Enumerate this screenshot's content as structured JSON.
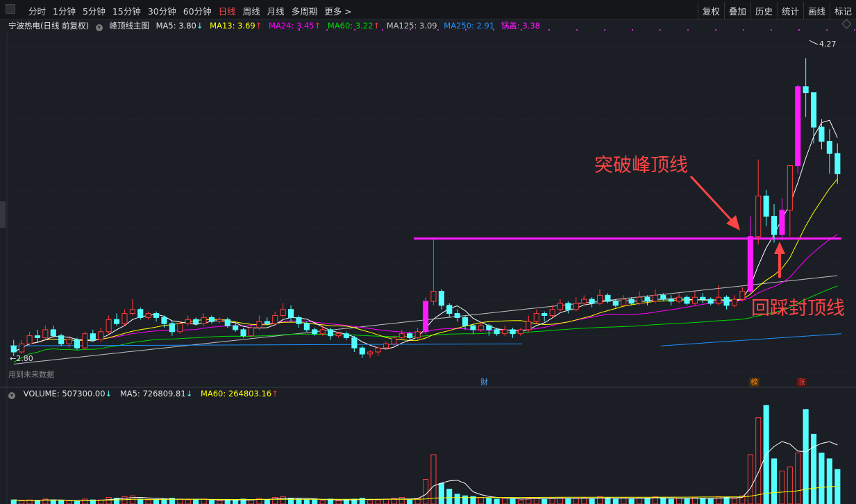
{
  "toolbar": {
    "periods": [
      "分时",
      "1分钟",
      "5分钟",
      "15分钟",
      "30分钟",
      "60分钟",
      "日线",
      "周线",
      "月线",
      "多周期",
      "更多 >"
    ],
    "active": "日线",
    "right_buttons": [
      "复权",
      "叠加",
      "历史",
      "统计",
      "画线",
      "标记"
    ]
  },
  "info": {
    "stock": "宁波热电(日线 前复权)",
    "indicator": "峰顶线主图",
    "ma5": "MA5: 3.80",
    "ma13": "MA13: 3.69",
    "ma24": "MA24: 3.45",
    "ma60": "MA60: 3.22",
    "ma125": "MA125: 3.09",
    "ma250": "MA250: 2.91",
    "guogai": "锅盖: 3.38"
  },
  "price_labels": {
    "high": "4.27",
    "low": "2.80",
    "future_note": "用到未来数据"
  },
  "badges": {
    "cai": "财",
    "bang": "榜",
    "zhang": "涨"
  },
  "annotations": {
    "breakout": "突破峰顶线",
    "pullback": "回踩封顶线"
  },
  "volume": {
    "volume": "VOLUME: 507300.00",
    "ma5": "MA5: 726809.81",
    "ma60": "MA60: 264803.16"
  },
  "colors": {
    "bg": "#1b1e25",
    "up": "#ff3b3b",
    "down": "#54ffff",
    "magenta": "#ff1aff",
    "ma5": "#ffffff",
    "ma13": "#ffff00",
    "ma24": "#ff00ff",
    "ma60": "#00d800",
    "ma125": "#c0c0c0",
    "ma250": "#1e90ff",
    "annotation": "#ff4545"
  },
  "chart_data": {
    "type": "candlestick",
    "ylim": [
      2.7,
      4.4
    ],
    "peak_line": 3.38,
    "candles": [
      [
        2.85,
        2.82,
        2.88,
        2.8
      ],
      [
        2.82,
        2.86,
        2.88,
        2.81
      ],
      [
        2.86,
        2.9,
        2.92,
        2.85
      ],
      [
        2.9,
        2.89,
        2.93,
        2.87
      ],
      [
        2.89,
        2.93,
        2.95,
        2.88
      ],
      [
        2.93,
        2.9,
        2.95,
        2.89
      ],
      [
        2.9,
        2.86,
        2.91,
        2.85
      ],
      [
        2.86,
        2.88,
        2.9,
        2.84
      ],
      [
        2.88,
        2.84,
        2.89,
        2.83
      ],
      [
        2.84,
        2.91,
        2.92,
        2.83
      ],
      [
        2.91,
        2.88,
        2.93,
        2.87
      ],
      [
        2.88,
        2.92,
        2.94,
        2.87
      ],
      [
        2.92,
        2.98,
        3.0,
        2.91
      ],
      [
        2.98,
        2.96,
        3.01,
        2.95
      ],
      [
        2.96,
        3.01,
        3.03,
        2.95
      ],
      [
        3.01,
        3.03,
        3.08,
        3.0
      ],
      [
        3.03,
        2.99,
        3.04,
        2.98
      ],
      [
        2.99,
        3.01,
        3.02,
        2.98
      ],
      [
        3.01,
        2.99,
        3.02,
        2.97
      ],
      [
        2.99,
        2.96,
        3.0,
        2.94
      ],
      [
        2.96,
        2.92,
        2.97,
        2.9
      ],
      [
        2.92,
        2.96,
        2.97,
        2.91
      ],
      [
        2.96,
        2.98,
        3.0,
        2.95
      ],
      [
        2.98,
        2.96,
        2.99,
        2.95
      ],
      [
        2.96,
        2.99,
        3.01,
        2.95
      ],
      [
        2.99,
        2.97,
        3.0,
        2.96
      ],
      [
        2.97,
        2.98,
        2.99,
        2.96
      ],
      [
        2.98,
        2.95,
        2.99,
        2.94
      ],
      [
        2.95,
        2.93,
        2.96,
        2.92
      ],
      [
        2.93,
        2.9,
        2.94,
        2.89
      ],
      [
        2.9,
        2.94,
        2.95,
        2.89
      ],
      [
        2.94,
        2.97,
        3.0,
        2.93
      ],
      [
        2.97,
        2.96,
        2.99,
        2.95
      ],
      [
        2.96,
        3.0,
        3.02,
        2.95
      ],
      [
        3.0,
        3.03,
        3.06,
        2.99
      ],
      [
        3.03,
        2.99,
        3.05,
        2.97
      ],
      [
        2.99,
        2.96,
        3.0,
        2.94
      ],
      [
        2.96,
        2.93,
        2.97,
        2.92
      ],
      [
        2.93,
        2.91,
        2.94,
        2.9
      ],
      [
        2.91,
        2.93,
        2.95,
        2.9
      ],
      [
        2.93,
        2.9,
        2.94,
        2.88
      ],
      [
        2.9,
        2.91,
        2.92,
        2.89
      ],
      [
        2.91,
        2.89,
        2.92,
        2.88
      ],
      [
        2.89,
        2.84,
        2.9,
        2.82
      ],
      [
        2.84,
        2.81,
        2.85,
        2.79
      ],
      [
        2.81,
        2.82,
        2.83,
        2.79
      ],
      [
        2.82,
        2.84,
        2.85,
        2.8
      ],
      [
        2.84,
        2.86,
        2.87,
        2.83
      ],
      [
        2.86,
        2.89,
        2.9,
        2.85
      ],
      [
        2.89,
        2.91,
        2.93,
        2.88
      ],
      [
        2.91,
        2.89,
        2.92,
        2.88
      ],
      [
        2.89,
        2.92,
        2.94,
        2.88
      ],
      [
        2.92,
        3.07,
        3.09,
        2.91
      ],
      [
        3.07,
        3.12,
        3.38,
        3.05
      ],
      [
        3.12,
        3.05,
        3.13,
        3.03
      ],
      [
        3.05,
        3.01,
        3.06,
        2.99
      ],
      [
        3.01,
        2.99,
        3.03,
        2.97
      ],
      [
        2.99,
        2.95,
        3.0,
        2.93
      ],
      [
        2.95,
        2.93,
        2.96,
        2.91
      ],
      [
        2.93,
        2.95,
        2.97,
        2.92
      ],
      [
        2.95,
        2.93,
        2.96,
        2.9
      ],
      [
        2.93,
        2.91,
        2.94,
        2.9
      ],
      [
        2.91,
        2.93,
        2.95,
        2.9
      ],
      [
        2.93,
        2.91,
        2.94,
        2.89
      ],
      [
        2.91,
        2.93,
        2.94,
        2.9
      ],
      [
        2.93,
        2.97,
        3.0,
        2.92
      ],
      [
        2.97,
        3.01,
        3.03,
        2.96
      ],
      [
        3.01,
        3.0,
        3.02,
        2.97
      ],
      [
        3.0,
        3.03,
        3.05,
        2.99
      ],
      [
        3.03,
        3.06,
        3.08,
        3.02
      ],
      [
        3.06,
        3.03,
        3.07,
        3.01
      ],
      [
        3.03,
        3.06,
        3.09,
        3.02
      ],
      [
        3.06,
        3.08,
        3.1,
        3.05
      ],
      [
        3.08,
        3.06,
        3.09,
        3.04
      ],
      [
        3.06,
        3.1,
        3.13,
        3.05
      ],
      [
        3.1,
        3.07,
        3.11,
        3.06
      ],
      [
        3.07,
        3.05,
        3.08,
        3.04
      ],
      [
        3.05,
        3.08,
        3.1,
        3.04
      ],
      [
        3.08,
        3.06,
        3.09,
        3.05
      ],
      [
        3.06,
        3.09,
        3.12,
        3.05
      ],
      [
        3.09,
        3.07,
        3.1,
        3.05
      ],
      [
        3.07,
        3.1,
        3.13,
        3.06
      ],
      [
        3.1,
        3.08,
        3.11,
        3.07
      ],
      [
        3.08,
        3.07,
        3.1,
        3.05
      ],
      [
        3.07,
        3.09,
        3.11,
        3.06
      ],
      [
        3.09,
        3.06,
        3.1,
        3.05
      ],
      [
        3.06,
        3.09,
        3.12,
        3.05
      ],
      [
        3.09,
        3.08,
        3.11,
        3.06
      ],
      [
        3.08,
        3.06,
        3.09,
        3.05
      ],
      [
        3.06,
        3.09,
        3.15,
        3.05
      ],
      [
        3.09,
        3.05,
        3.1,
        3.03
      ],
      [
        3.05,
        3.08,
        3.1,
        3.04
      ],
      [
        3.08,
        3.12,
        3.14,
        3.07
      ],
      [
        3.12,
        3.39,
        3.49,
        3.11
      ],
      [
        3.39,
        3.59,
        3.77,
        3.35
      ],
      [
        3.59,
        3.49,
        3.62,
        3.44
      ],
      [
        3.49,
        3.4,
        3.55,
        3.36
      ],
      [
        3.4,
        3.52,
        3.58,
        3.37
      ],
      [
        3.52,
        3.74,
        3.74,
        3.39
      ],
      [
        3.74,
        4.13,
        4.14,
        3.7
      ],
      [
        4.13,
        4.1,
        4.27,
        3.98
      ],
      [
        4.1,
        3.93,
        4.05,
        3.85
      ],
      [
        3.93,
        3.86,
        3.97,
        3.82
      ],
      [
        3.86,
        3.8,
        3.92,
        3.7
      ],
      [
        3.8,
        3.7,
        3.85,
        3.65
      ]
    ],
    "volumes": [
      0.05,
      0.04,
      0.05,
      0.04,
      0.06,
      0.05,
      0.04,
      0.04,
      0.03,
      0.06,
      0.05,
      0.05,
      0.08,
      0.07,
      0.09,
      0.1,
      0.06,
      0.05,
      0.05,
      0.06,
      0.07,
      0.06,
      0.05,
      0.05,
      0.06,
      0.05,
      0.04,
      0.05,
      0.05,
      0.06,
      0.05,
      0.07,
      0.05,
      0.08,
      0.09,
      0.07,
      0.06,
      0.05,
      0.05,
      0.04,
      0.06,
      0.04,
      0.05,
      0.06,
      0.07,
      0.05,
      0.05,
      0.06,
      0.07,
      0.08,
      0.05,
      0.07,
      0.3,
      0.6,
      0.25,
      0.18,
      0.12,
      0.1,
      0.09,
      0.08,
      0.07,
      0.06,
      0.07,
      0.06,
      0.05,
      0.07,
      0.08,
      0.06,
      0.07,
      0.08,
      0.06,
      0.07,
      0.08,
      0.06,
      0.09,
      0.07,
      0.06,
      0.08,
      0.06,
      0.08,
      0.07,
      0.09,
      0.07,
      0.06,
      0.07,
      0.06,
      0.08,
      0.07,
      0.06,
      0.09,
      0.08,
      0.07,
      0.1,
      0.6,
      1.05,
      1.2,
      0.55,
      0.4,
      0.45,
      0.62,
      1.15,
      0.85,
      0.62,
      0.55,
      0.42
    ]
  }
}
